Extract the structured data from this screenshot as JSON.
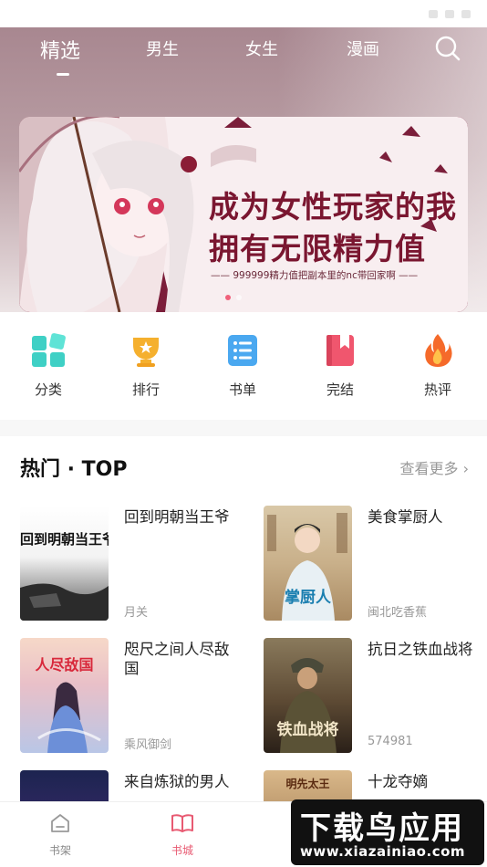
{
  "tabs": {
    "featured": "精选",
    "male": "男生",
    "female": "女生",
    "comic": "漫画"
  },
  "banner": {
    "line1": "成为女性玩家的我",
    "line2": "拥有无限精力值",
    "subtitle": "—— 999999精力值把副本里的nc带回家啊 ——"
  },
  "quick_links": [
    {
      "label": "分类",
      "icon": "grid-icon"
    },
    {
      "label": "排行",
      "icon": "trophy-icon"
    },
    {
      "label": "书单",
      "icon": "list-icon"
    },
    {
      "label": "完结",
      "icon": "bookmark-icon"
    },
    {
      "label": "热评",
      "icon": "flame-icon"
    }
  ],
  "hot": {
    "title": "热门 · TOP",
    "more": "查看更多",
    "books": [
      {
        "title": "回到明朝当王爷",
        "author": "月关",
        "cover_text": "回到明朝当王爷"
      },
      {
        "title": "美食掌厨人",
        "author": "闽北吃香蕉",
        "cover_text": "掌厨人"
      },
      {
        "title": "咫尺之间人尽敌国",
        "author": "乘风御剑",
        "cover_text": "人尽敌国"
      },
      {
        "title": "抗日之铁血战将",
        "author": "574981",
        "cover_text": "铁血战将"
      },
      {
        "title": "来自炼狱的男人",
        "author": "",
        "cover_text": ""
      },
      {
        "title": "十龙夺嫡",
        "author": "",
        "cover_text": "明先太王"
      }
    ]
  },
  "nav": {
    "shelf": "书架",
    "store": "书城"
  },
  "watermark": {
    "main": "下载鸟应用",
    "sub": "www.xiazainiao.com"
  },
  "colors": {
    "accent": "#e85a72",
    "hero_top": "#a88790",
    "banner_bg": "#7b1e3a"
  }
}
